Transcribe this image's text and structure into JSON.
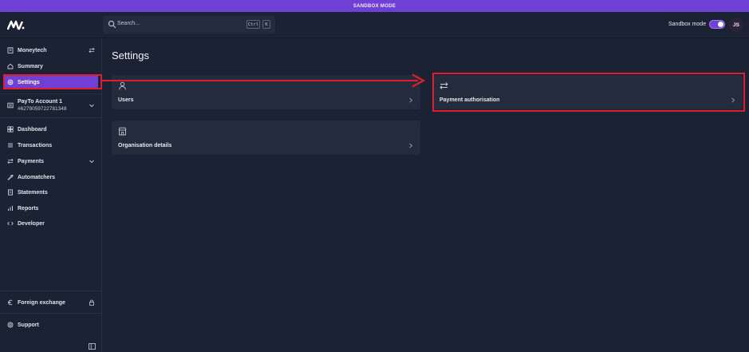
{
  "banner": {
    "text": "SANDBOX MODE"
  },
  "topbar": {
    "logo_icon": "moneytech-logo-icon",
    "search": {
      "placeholder": "Search...",
      "shortcut_ctrl": "Ctrl",
      "shortcut_key": "K"
    },
    "sandbox_label": "Sandbox mode",
    "sandbox_enabled": true,
    "avatar_initials": "JS"
  },
  "sidebar": {
    "org": {
      "label": "Moneytech",
      "icon": "building-icon",
      "switch_icon": "swap-icon"
    },
    "items_top": [
      {
        "label": "Summary",
        "icon": "home-icon"
      },
      {
        "label": "Settings",
        "icon": "gear-icon",
        "active": true
      }
    ],
    "account": {
      "name": "PayTo Account 1",
      "number": "#6279059722781348",
      "icon": "account-icon"
    },
    "items_main": [
      {
        "label": "Dashboard",
        "icon": "dashboard-icon"
      },
      {
        "label": "Transactions",
        "icon": "list-icon"
      },
      {
        "label": "Payments",
        "icon": "transfer-icon",
        "expandable": true
      },
      {
        "label": "Automatchers",
        "icon": "wrench-icon"
      },
      {
        "label": "Statements",
        "icon": "document-icon"
      },
      {
        "label": "Reports",
        "icon": "chart-icon"
      },
      {
        "label": "Developer",
        "icon": "code-icon"
      }
    ],
    "items_bottom": [
      {
        "label": "Foreign exchange",
        "icon": "euro-icon",
        "locked": true
      },
      {
        "label": "Support",
        "icon": "support-icon"
      }
    ]
  },
  "main": {
    "title": "Settings",
    "cards": [
      {
        "label": "Users",
        "icon": "user-icon"
      },
      {
        "label": "Organisation details",
        "icon": "storefront-icon"
      },
      {
        "label": "Payment authorisation",
        "icon": "transfer-icon"
      }
    ]
  },
  "annotation": {
    "color": "#e01e2b"
  },
  "colors": {
    "accent": "#6f3fd6",
    "background": "#1b2233",
    "card": "#232b3d"
  }
}
